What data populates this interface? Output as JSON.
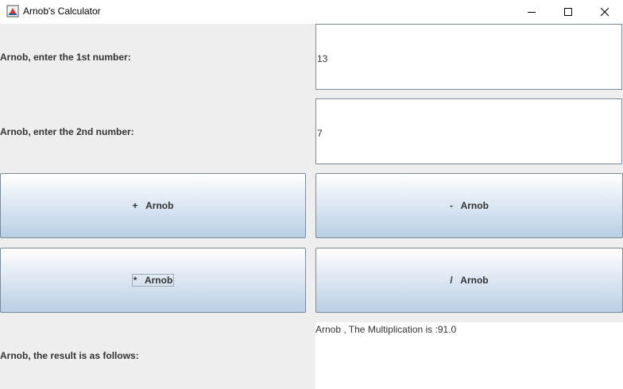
{
  "window": {
    "title": "Arnob's Calculator",
    "icons": {
      "app": "java-app-icon",
      "minimize": "minimize-icon",
      "maximize": "maximize-icon",
      "close": "close-icon"
    }
  },
  "form": {
    "first_label": "Arnob, enter the 1st number:",
    "first_value": "13",
    "second_label": "Arnob, enter the 2nd number:",
    "second_value": "7",
    "result_label": "Arnob, the result is as follows:",
    "result_value": "Arnob , The Multiplication is :91.0"
  },
  "buttons": {
    "add": "+   Arnob",
    "subtract": "-   Arnob",
    "multiply": "*   Arnob",
    "divide": "/   Arnob"
  },
  "colors": {
    "panel_bg": "#eeeeee",
    "button_gradient_top": "#ffffff",
    "button_gradient_bottom": "#b8cfe5",
    "border": "#7a8a99",
    "text": "#333333"
  }
}
